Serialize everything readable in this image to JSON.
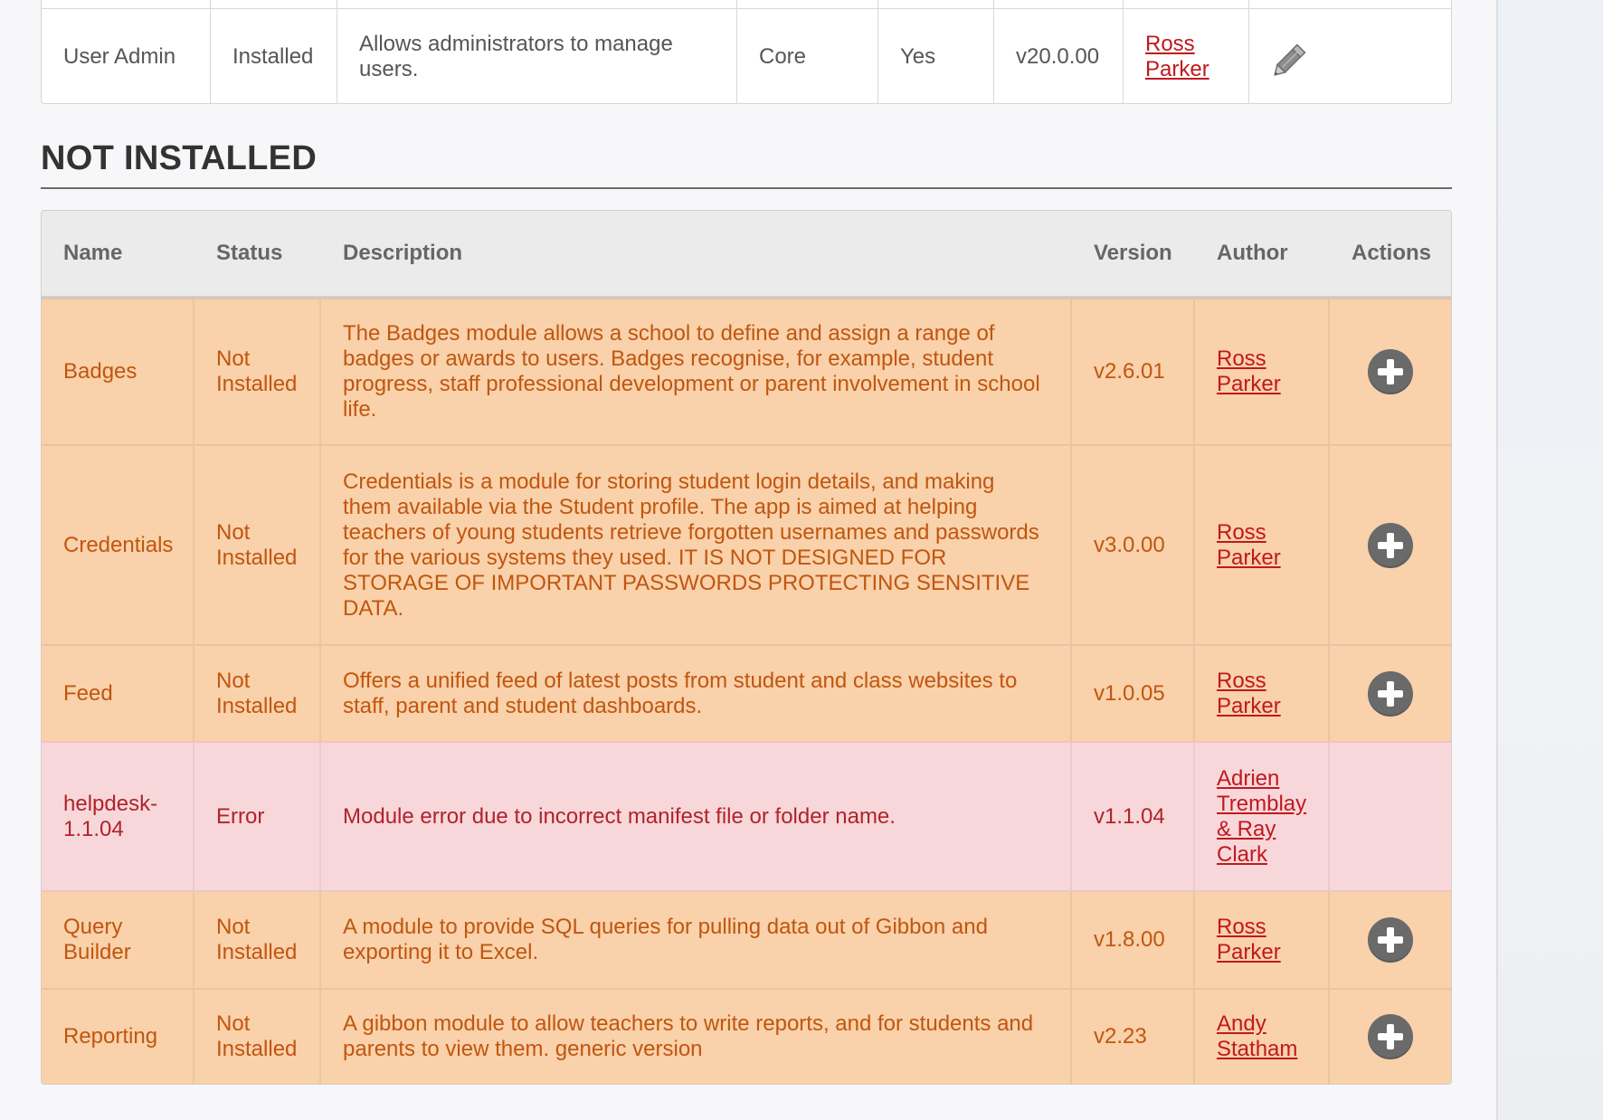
{
  "installed_row": {
    "name": "User Admin",
    "status": "Installed",
    "description": "Allows administrators to manage users.",
    "type": "Core",
    "active": "Yes",
    "version": "v20.0.00",
    "author": "Ross Parker",
    "action_icon": "pencil-icon"
  },
  "section_title": "NOT INSTALLED",
  "table": {
    "headers": {
      "name": "Name",
      "status": "Status",
      "description": "Description",
      "version": "Version",
      "author": "Author",
      "actions": "Actions"
    },
    "rows": [
      {
        "name": "Badges",
        "status": "Not Installed",
        "description": "The Badges module allows a school to define and assign a range of badges or awards to users. Badges recognise, for example, student progress, staff professional development or parent involvement in school life.",
        "version": "v2.6.01",
        "author": "Ross Parker",
        "state": "warning",
        "action_icon": "plus-circle-icon"
      },
      {
        "name": "Credentials",
        "status": "Not Installed",
        "description": "Credentials is a module for storing student login details, and making them available via the Student profile. The app is aimed at helping teachers of young students retrieve forgotten usernames and passwords for the various systems they used. IT IS NOT DESIGNED FOR STORAGE OF IMPORTANT PASSWORDS PROTECTING SENSITIVE DATA.",
        "version": "v3.0.00",
        "author": "Ross Parker",
        "state": "warning",
        "action_icon": "plus-circle-icon"
      },
      {
        "name": "Feed",
        "status": "Not Installed",
        "description": "Offers a unified feed of latest posts from student and class websites to staff, parent and student dashboards.",
        "version": "v1.0.05",
        "author": "Ross Parker",
        "state": "warning",
        "action_icon": "plus-circle-icon"
      },
      {
        "name": "helpdesk-1.1.04",
        "status": "Error",
        "description": "Module error due to incorrect manifest file or folder name.",
        "version": "v1.1.04",
        "author": "Adrien Tremblay & Ray Clark",
        "state": "error",
        "action_icon": ""
      },
      {
        "name": "Query Builder",
        "status": "Not Installed",
        "description": "A module to provide SQL queries for pulling data out of Gibbon and exporting it to Excel.",
        "version": "v1.8.00",
        "author": "Ross Parker",
        "state": "warning",
        "action_icon": "plus-circle-icon"
      },
      {
        "name": "Reporting",
        "status": "Not Installed",
        "description": "A gibbon module to allow teachers to write reports, and for students and parents to view them. generic version",
        "version": "v2.23",
        "author": "Andy Statham",
        "state": "warning",
        "action_icon": "plus-circle-icon"
      }
    ]
  },
  "colors": {
    "warning_bg": "#f9d1aa",
    "warning_text": "#c1560f",
    "error_bg": "#f8d7da",
    "error_text": "#b0232a",
    "link": "#c0191e"
  }
}
